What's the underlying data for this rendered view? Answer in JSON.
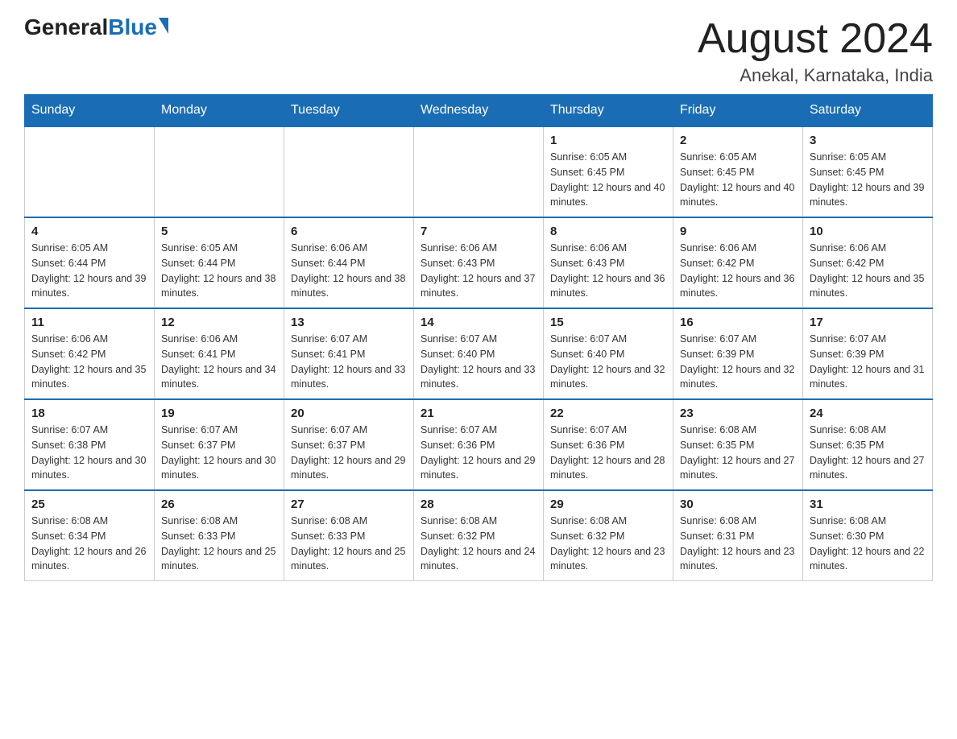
{
  "logo": {
    "general": "General",
    "blue": "Blue",
    "triangle": "▲"
  },
  "header": {
    "month_title": "August 2024",
    "location": "Anekal, Karnataka, India"
  },
  "days_of_week": [
    "Sunday",
    "Monday",
    "Tuesday",
    "Wednesday",
    "Thursday",
    "Friday",
    "Saturday"
  ],
  "weeks": [
    [
      {
        "day": "",
        "info": ""
      },
      {
        "day": "",
        "info": ""
      },
      {
        "day": "",
        "info": ""
      },
      {
        "day": "",
        "info": ""
      },
      {
        "day": "1",
        "info": "Sunrise: 6:05 AM\nSunset: 6:45 PM\nDaylight: 12 hours and 40 minutes."
      },
      {
        "day": "2",
        "info": "Sunrise: 6:05 AM\nSunset: 6:45 PM\nDaylight: 12 hours and 40 minutes."
      },
      {
        "day": "3",
        "info": "Sunrise: 6:05 AM\nSunset: 6:45 PM\nDaylight: 12 hours and 39 minutes."
      }
    ],
    [
      {
        "day": "4",
        "info": "Sunrise: 6:05 AM\nSunset: 6:44 PM\nDaylight: 12 hours and 39 minutes."
      },
      {
        "day": "5",
        "info": "Sunrise: 6:05 AM\nSunset: 6:44 PM\nDaylight: 12 hours and 38 minutes."
      },
      {
        "day": "6",
        "info": "Sunrise: 6:06 AM\nSunset: 6:44 PM\nDaylight: 12 hours and 38 minutes."
      },
      {
        "day": "7",
        "info": "Sunrise: 6:06 AM\nSunset: 6:43 PM\nDaylight: 12 hours and 37 minutes."
      },
      {
        "day": "8",
        "info": "Sunrise: 6:06 AM\nSunset: 6:43 PM\nDaylight: 12 hours and 36 minutes."
      },
      {
        "day": "9",
        "info": "Sunrise: 6:06 AM\nSunset: 6:42 PM\nDaylight: 12 hours and 36 minutes."
      },
      {
        "day": "10",
        "info": "Sunrise: 6:06 AM\nSunset: 6:42 PM\nDaylight: 12 hours and 35 minutes."
      }
    ],
    [
      {
        "day": "11",
        "info": "Sunrise: 6:06 AM\nSunset: 6:42 PM\nDaylight: 12 hours and 35 minutes."
      },
      {
        "day": "12",
        "info": "Sunrise: 6:06 AM\nSunset: 6:41 PM\nDaylight: 12 hours and 34 minutes."
      },
      {
        "day": "13",
        "info": "Sunrise: 6:07 AM\nSunset: 6:41 PM\nDaylight: 12 hours and 33 minutes."
      },
      {
        "day": "14",
        "info": "Sunrise: 6:07 AM\nSunset: 6:40 PM\nDaylight: 12 hours and 33 minutes."
      },
      {
        "day": "15",
        "info": "Sunrise: 6:07 AM\nSunset: 6:40 PM\nDaylight: 12 hours and 32 minutes."
      },
      {
        "day": "16",
        "info": "Sunrise: 6:07 AM\nSunset: 6:39 PM\nDaylight: 12 hours and 32 minutes."
      },
      {
        "day": "17",
        "info": "Sunrise: 6:07 AM\nSunset: 6:39 PM\nDaylight: 12 hours and 31 minutes."
      }
    ],
    [
      {
        "day": "18",
        "info": "Sunrise: 6:07 AM\nSunset: 6:38 PM\nDaylight: 12 hours and 30 minutes."
      },
      {
        "day": "19",
        "info": "Sunrise: 6:07 AM\nSunset: 6:37 PM\nDaylight: 12 hours and 30 minutes."
      },
      {
        "day": "20",
        "info": "Sunrise: 6:07 AM\nSunset: 6:37 PM\nDaylight: 12 hours and 29 minutes."
      },
      {
        "day": "21",
        "info": "Sunrise: 6:07 AM\nSunset: 6:36 PM\nDaylight: 12 hours and 29 minutes."
      },
      {
        "day": "22",
        "info": "Sunrise: 6:07 AM\nSunset: 6:36 PM\nDaylight: 12 hours and 28 minutes."
      },
      {
        "day": "23",
        "info": "Sunrise: 6:08 AM\nSunset: 6:35 PM\nDaylight: 12 hours and 27 minutes."
      },
      {
        "day": "24",
        "info": "Sunrise: 6:08 AM\nSunset: 6:35 PM\nDaylight: 12 hours and 27 minutes."
      }
    ],
    [
      {
        "day": "25",
        "info": "Sunrise: 6:08 AM\nSunset: 6:34 PM\nDaylight: 12 hours and 26 minutes."
      },
      {
        "day": "26",
        "info": "Sunrise: 6:08 AM\nSunset: 6:33 PM\nDaylight: 12 hours and 25 minutes."
      },
      {
        "day": "27",
        "info": "Sunrise: 6:08 AM\nSunset: 6:33 PM\nDaylight: 12 hours and 25 minutes."
      },
      {
        "day": "28",
        "info": "Sunrise: 6:08 AM\nSunset: 6:32 PM\nDaylight: 12 hours and 24 minutes."
      },
      {
        "day": "29",
        "info": "Sunrise: 6:08 AM\nSunset: 6:32 PM\nDaylight: 12 hours and 23 minutes."
      },
      {
        "day": "30",
        "info": "Sunrise: 6:08 AM\nSunset: 6:31 PM\nDaylight: 12 hours and 23 minutes."
      },
      {
        "day": "31",
        "info": "Sunrise: 6:08 AM\nSunset: 6:30 PM\nDaylight: 12 hours and 22 minutes."
      }
    ]
  ]
}
